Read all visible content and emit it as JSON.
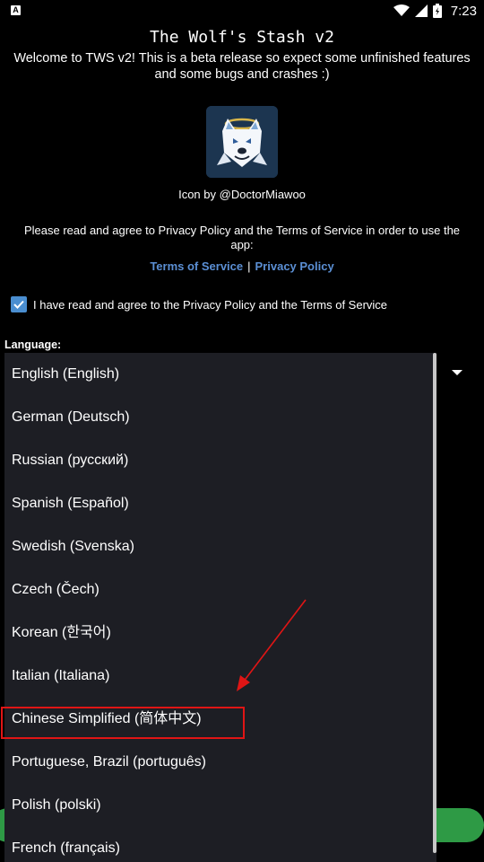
{
  "status_bar": {
    "app_icon": "A",
    "icons": [
      "wifi-icon",
      "signal-icon",
      "battery-icon"
    ],
    "time": "7:23"
  },
  "header": {
    "title": "The Wolf's Stash v2",
    "welcome_line1": "Welcome to TWS v2! This is a beta release so expect some unfinished features",
    "welcome_line2": "and some bugs and crashes :)"
  },
  "icon_credit": "Icon by @DoctorMiawoo",
  "agreement": {
    "text_line1": "Please read and agree to Privacy Policy and the Terms of Service in order to use the",
    "text_line2": "app:",
    "terms_link": "Terms of Service",
    "separator": "|",
    "privacy_link": "Privacy Policy",
    "checkbox_checked": true,
    "checkbox_label": "I have read and agree to the Privacy Policy and the Terms of Service"
  },
  "language": {
    "label": "Language:",
    "options": [
      "English (English)",
      "German (Deutsch)",
      "Russian (русский)",
      "Spanish (Español)",
      "Swedish (Svenska)",
      "Czech (Čech)",
      "Korean (한국어)",
      "Italian (Italiana)",
      "Chinese Simplified (简体中文)",
      "Portuguese, Brazil (português)",
      "Polish (polski)",
      "French (français)"
    ],
    "highlighted_option": "Chinese Simplified (简体中文)"
  },
  "colors": {
    "background": "#000000",
    "popup": "#1d1e24",
    "link": "#5b8fd4",
    "checkbox": "#4a8ed0",
    "annotation": "#e01515",
    "button_green": "#2e9a45"
  }
}
